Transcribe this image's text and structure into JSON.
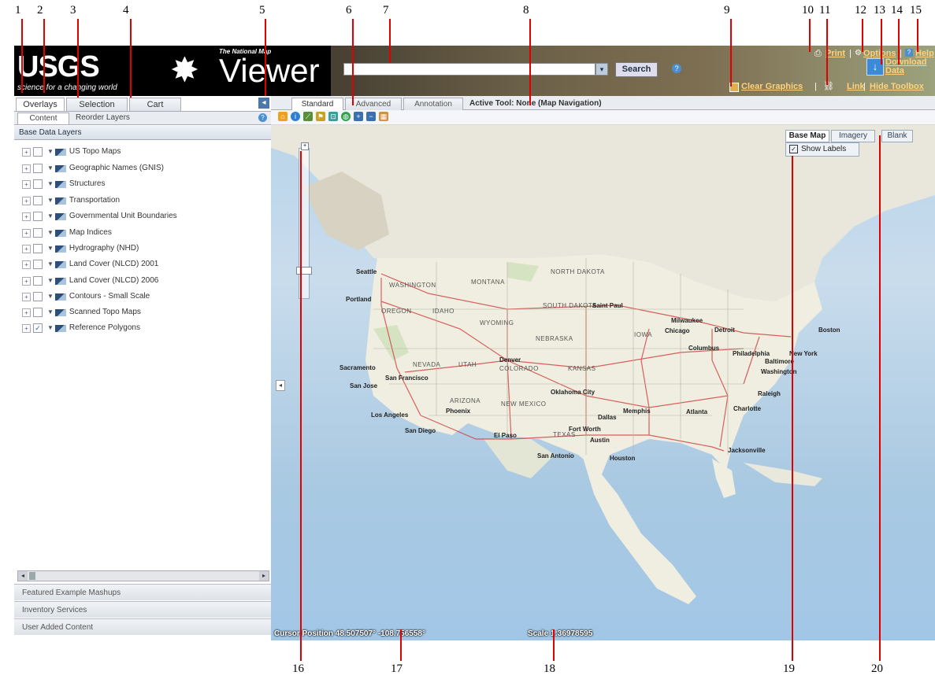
{
  "callouts": [
    "1",
    "2",
    "3",
    "4",
    "5",
    "6",
    "7",
    "8",
    "9",
    "10",
    "11",
    "12",
    "13",
    "14",
    "15",
    "16",
    "17",
    "18",
    "19",
    "20"
  ],
  "header": {
    "usgs_mark": "USGS",
    "usgs_tagline": "science for a changing world",
    "viewer_super": "The National Map",
    "viewer_title": "Viewer",
    "search_value": "",
    "search_button": "Search",
    "help_glyph": "?",
    "clear_graphics": "Clear Graphics",
    "link": "Link",
    "hide_toolbox": "Hide Toolbox",
    "print": "Print",
    "options": "Options",
    "help": "Help",
    "download_data": "Download Data"
  },
  "left_panel": {
    "tabs": [
      "Overlays",
      "Selection",
      "Cart"
    ],
    "subtabs": [
      "Content",
      "Reorder Layers"
    ],
    "section_header": "Base Data Layers",
    "layers": [
      {
        "label": "US Topo Maps",
        "checked": false
      },
      {
        "label": "Geographic Names (GNIS)",
        "checked": false
      },
      {
        "label": "Structures",
        "checked": false
      },
      {
        "label": "Transportation",
        "checked": false
      },
      {
        "label": "Governmental Unit Boundaries",
        "checked": false
      },
      {
        "label": "Map Indices",
        "checked": false
      },
      {
        "label": "Hydrography (NHD)",
        "checked": false
      },
      {
        "label": "Land Cover (NLCD) 2001",
        "checked": false
      },
      {
        "label": "Land Cover (NLCD) 2006",
        "checked": false
      },
      {
        "label": "Contours - Small Scale",
        "checked": false
      },
      {
        "label": "Scanned Topo Maps",
        "checked": false
      },
      {
        "label": "Reference Polygons",
        "checked": true
      }
    ],
    "accordions": [
      "Featured Example Mashups",
      "Inventory Services",
      "User Added Content"
    ]
  },
  "map_toolbar": {
    "tabs": [
      "Standard",
      "Advanced",
      "Annotation"
    ],
    "active_tool": "Active Tool: None (Map Navigation)"
  },
  "map": {
    "basemap_buttons": [
      "Base Map",
      "Imagery",
      "Blank"
    ],
    "show_labels": "Show Labels",
    "cursor_position": "Cursor Position 48.507507° -108.756558°",
    "scale": "Scale 1:36978595",
    "cities": [
      "Seattle",
      "Portland",
      "Sacramento",
      "San Francisco",
      "San Jose",
      "Los Angeles",
      "San Diego",
      "Phoenix",
      "El Paso",
      "Denver",
      "Oklahoma City",
      "Dallas",
      "Fort Worth",
      "Austin",
      "San Antonio",
      "Houston",
      "Saint Paul",
      "Milwaukee",
      "Chicago",
      "Detroit",
      "Columbus",
      "Philadelphia",
      "New York",
      "Baltimore",
      "Washington",
      "Boston",
      "Memphis",
      "Atlanta",
      "Charlotte",
      "Raleigh",
      "Jacksonville"
    ],
    "states": [
      "WASHINGTON",
      "OREGON",
      "IDAHO",
      "MONTANA",
      "WYOMING",
      "NEVADA",
      "UTAH",
      "COLORADO",
      "ARIZONA",
      "NEW MEXICO",
      "TEXAS",
      "NORTH DAKOTA",
      "SOUTH DAKOTA",
      "NEBRASKA",
      "KANSAS",
      "IOWA"
    ]
  }
}
